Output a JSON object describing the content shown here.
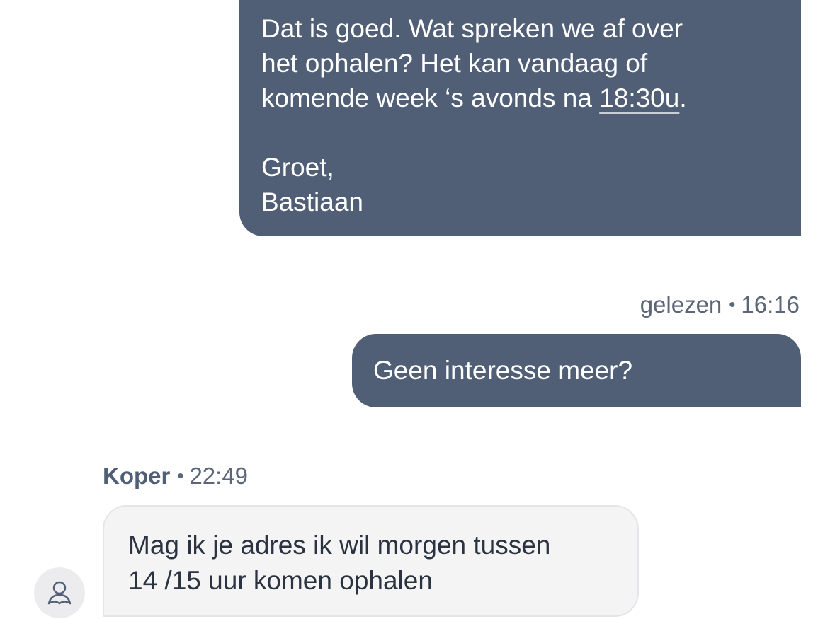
{
  "messages": {
    "outgoing_1": {
      "line1": "Dat is goed. Wat spreken we af over",
      "line2": "het ophalen? Het kan vandaag of",
      "line3_prefix": "komende week ‘s avonds na ",
      "time_link": "18:30u",
      "line3_suffix": ".",
      "greeting": "Groet,",
      "signature": "Bastiaan"
    },
    "outgoing_meta": {
      "status": "gelezen",
      "separator": "•",
      "time": "16:16"
    },
    "outgoing_2": {
      "text": "Geen interesse meer?"
    },
    "incoming_meta": {
      "sender": "Koper",
      "separator": "•",
      "time": "22:49"
    },
    "incoming_1": {
      "line1": "Mag ik je adres ik wil morgen tussen",
      "line2": "14 /15 uur komen ophalen"
    },
    "avatar_icon": "user-icon"
  },
  "colors": {
    "outgoing_bubble": "#505f76",
    "incoming_bubble": "#f4f4f5",
    "meta_text": "#5b6677"
  }
}
